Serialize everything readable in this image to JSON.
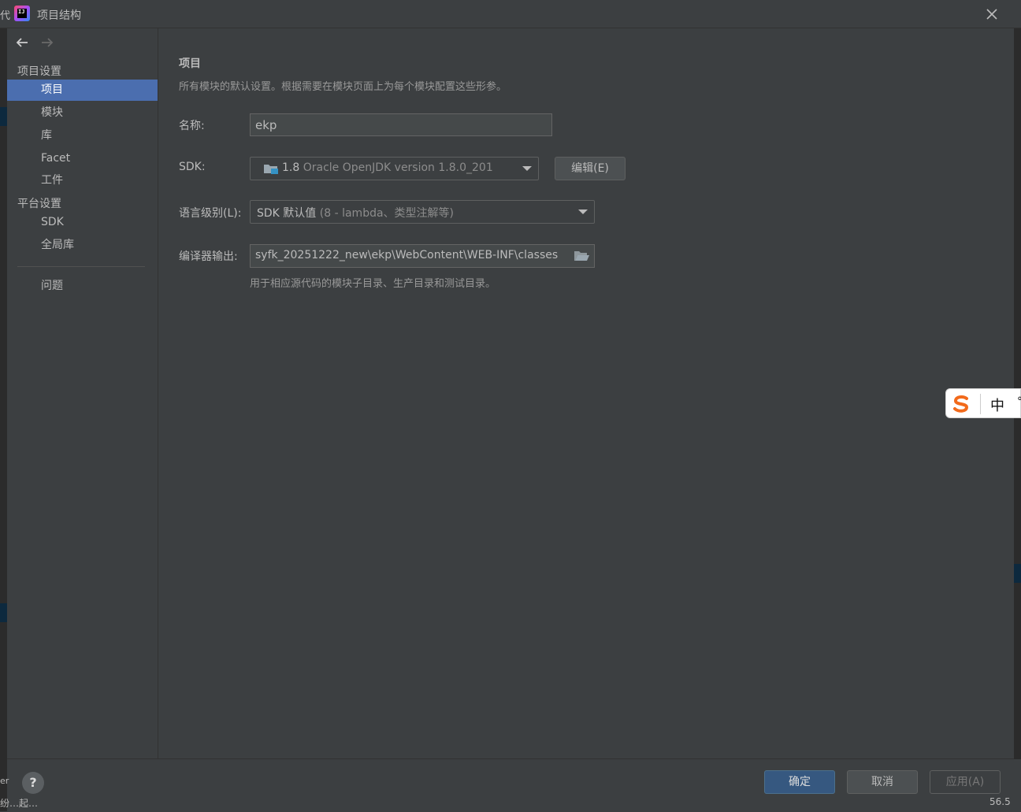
{
  "window": {
    "title": "项目结构",
    "left_clip_text": "代"
  },
  "sidebar": {
    "groups": [
      {
        "title": "项目设置",
        "items": [
          "项目",
          "模块",
          "库",
          "Facet",
          "工件"
        ]
      },
      {
        "title": "平台设置",
        "items": [
          "SDK",
          "全局库"
        ]
      }
    ],
    "problems_label": "问题",
    "selected": "项目"
  },
  "main": {
    "title": "项目",
    "description": "所有模块的默认设置。根据需要在模块页面上为每个模块配置这些形参。",
    "name_label": "名称:",
    "name_value": "ekp",
    "sdk_label": "SDK:",
    "sdk_version": "1.8",
    "sdk_detail": "Oracle OpenJDK version 1.8.0_201",
    "sdk_edit_button": "编辑(E)",
    "lang_label": "语言级别(L):",
    "lang_value": "SDK 默认值",
    "lang_detail": "(8 - lambda、类型注解等)",
    "output_label": "编译器输出:",
    "output_value": "syfk_20251222_new\\ekp\\WebContent\\WEB-INF\\classes",
    "output_hint": "用于相应源代码的模块子目录、生产目录和测试目录。"
  },
  "footer": {
    "help": "?",
    "ok": "确定",
    "cancel": "取消",
    "apply": "应用(A)"
  },
  "ime": {
    "mode": "中"
  },
  "background": {
    "bottom_left_1": "er",
    "bottom_left_2": "纷…起…",
    "bottom_right": "56.5"
  },
  "colors": {
    "background": "#3c3f41",
    "selection": "#4b6eaf",
    "ok_button": "#365880",
    "text": "#bbbbbb"
  }
}
